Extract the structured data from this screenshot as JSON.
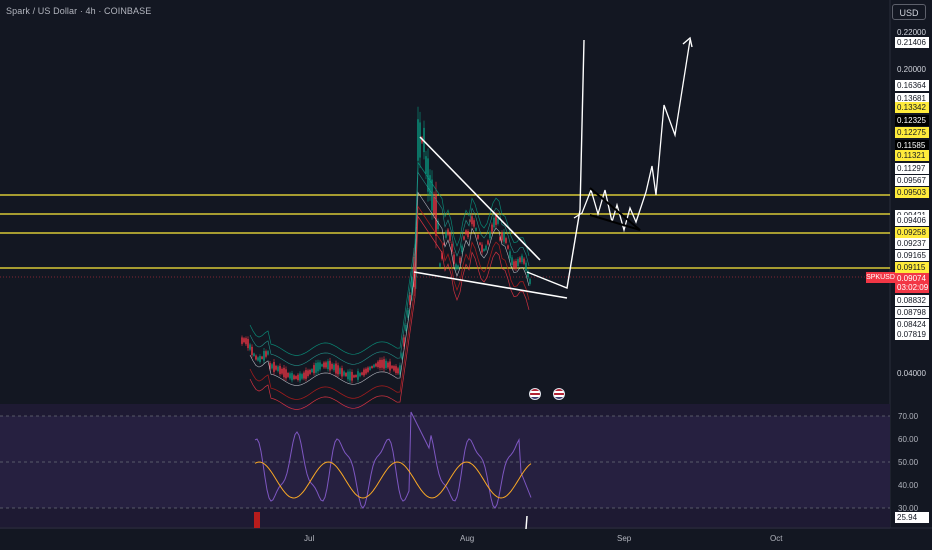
{
  "header": {
    "title": "Spark / US Dollar · 4h · COINBASE",
    "currency_button": "USD"
  },
  "colors": {
    "background": "#131722",
    "yellow_level": "#ffeb3b",
    "symbol_red": "#f23645",
    "rsi_line": "#7e57c2",
    "rsi_ma": "#f9a825",
    "drawing_white": "#ffffff"
  },
  "price_scale": {
    "plain_ticks": [
      "0.22000",
      "0.20000",
      "0.04000"
    ],
    "labels": [
      {
        "text": "0.21406",
        "style": "white"
      },
      {
        "text": "0.16364",
        "style": "white"
      },
      {
        "text": "0.13681",
        "style": "white"
      },
      {
        "text": "0.13342",
        "style": "yellow"
      },
      {
        "text": "0.12325",
        "style": "black"
      },
      {
        "text": "0.12275",
        "style": "yellow"
      },
      {
        "text": "0.11585",
        "style": "black"
      },
      {
        "text": "0.11321",
        "style": "yellow"
      },
      {
        "text": "0.11297",
        "style": "white"
      },
      {
        "text": "0.09567",
        "style": "white"
      },
      {
        "text": "0.09503",
        "style": "yellow"
      },
      {
        "text": "0.09421",
        "style": "white"
      },
      {
        "text": "0.09406",
        "style": "white"
      },
      {
        "text": "0.09258",
        "style": "yellow"
      },
      {
        "text": "0.09237",
        "style": "white"
      },
      {
        "text": "0.09165",
        "style": "white"
      },
      {
        "text": "0.09115",
        "style": "yellow"
      },
      {
        "text": "0.09074",
        "style": "red"
      },
      {
        "text": "0.08832",
        "style": "white"
      },
      {
        "text": "0.08798",
        "style": "white"
      },
      {
        "text": "0.08424",
        "style": "white"
      },
      {
        "text": "0.07819",
        "style": "white"
      }
    ],
    "symbol_badge": "SPKUSD",
    "countdown": "03:02:09"
  },
  "rsi": {
    "ticks": [
      "70.00",
      "60.00",
      "50.00",
      "40.00",
      "30.00"
    ],
    "current_value": "25.94"
  },
  "time_axis": [
    "Jul",
    "Aug",
    "Sep",
    "Oct"
  ]
}
